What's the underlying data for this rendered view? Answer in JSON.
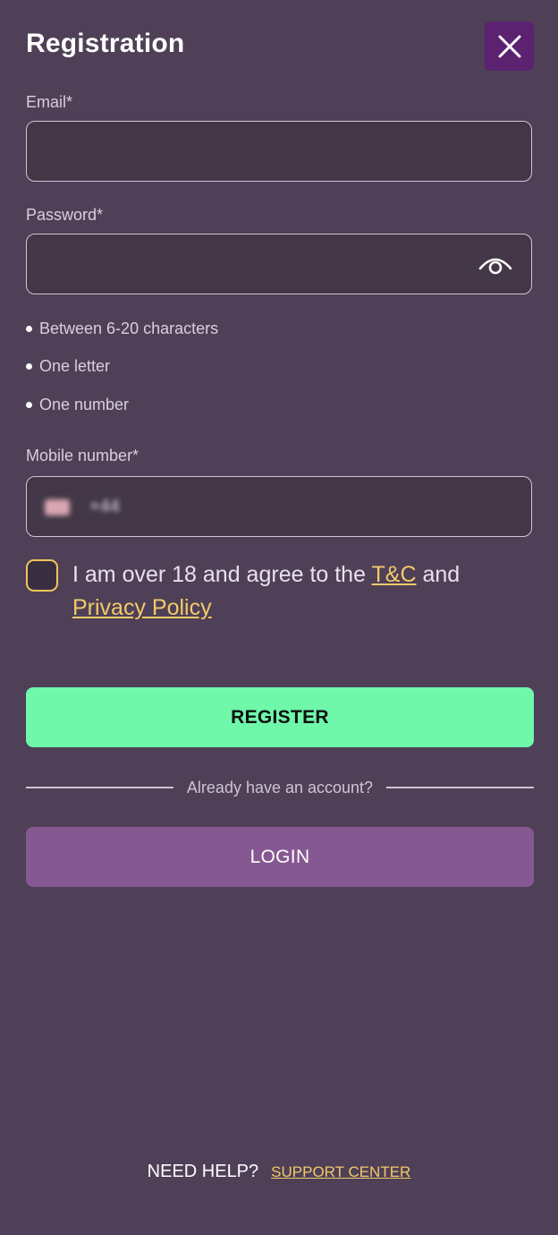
{
  "header": {
    "title": "Registration"
  },
  "email": {
    "label": "Email*",
    "value": "",
    "placeholder": ""
  },
  "password": {
    "label": "Password*",
    "value": "",
    "placeholder": "",
    "rules": [
      "Between 6-20 characters",
      "One letter",
      "One number"
    ]
  },
  "mobile": {
    "label": "Mobile number*",
    "prefix": "+44",
    "value": ""
  },
  "consent": {
    "text_before": "I am over 18 and agree to the ",
    "tc_link": "T&C",
    "text_middle": " and ",
    "privacy_link": "Privacy Policy",
    "checked": false
  },
  "actions": {
    "register_label": "REGISTER",
    "divider_text": "Already have an account?",
    "login_label": "LOGIN"
  },
  "footer": {
    "help_text": "NEED HELP?",
    "support_link": "SUPPORT CENTER"
  },
  "colors": {
    "background": "#4f4057",
    "register": "#6ff7aa",
    "login": "#865891",
    "link": "#f2c96a",
    "close_bg": "#5a2270"
  }
}
